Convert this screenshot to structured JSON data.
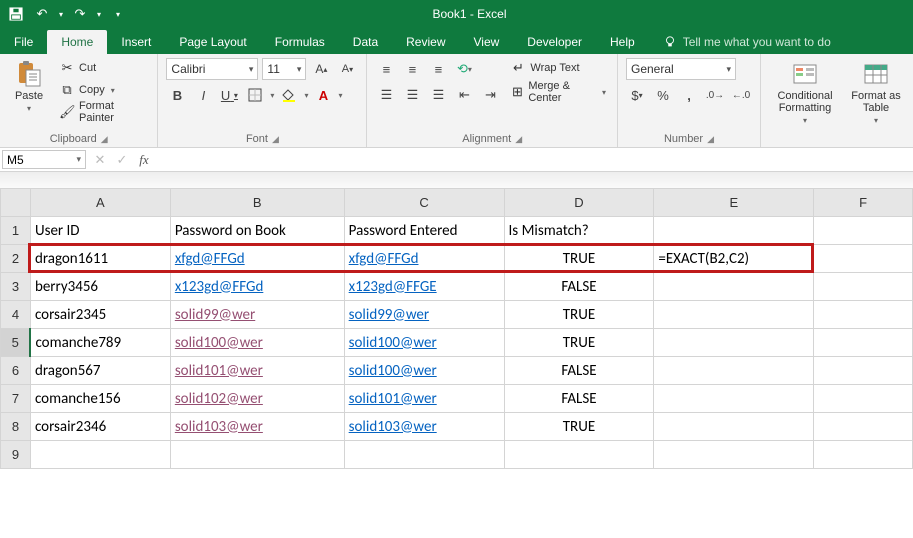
{
  "title": "Book1 - Excel",
  "qat": {
    "save": "💾",
    "undo": "↶",
    "redo": "↷"
  },
  "tabs": {
    "file": "File",
    "home": "Home",
    "insert": "Insert",
    "page_layout": "Page Layout",
    "formulas": "Formulas",
    "data": "Data",
    "review": "Review",
    "view": "View",
    "developer": "Developer",
    "help": "Help",
    "tellme": "Tell me what you want to do"
  },
  "ribbon": {
    "clipboard": {
      "label": "Clipboard",
      "paste": "Paste",
      "cut": "Cut",
      "copy": "Copy",
      "format_painter": "Format Painter"
    },
    "font": {
      "label": "Font",
      "font_name": "Calibri",
      "font_size": "11",
      "bold": "B",
      "italic": "I",
      "underline": "U"
    },
    "alignment": {
      "label": "Alignment",
      "wrap": "Wrap Text",
      "merge": "Merge & Center"
    },
    "number": {
      "label": "Number",
      "format": "General"
    },
    "styles": {
      "cond": "Conditional Formatting",
      "table": "Format as Table"
    }
  },
  "formula_bar": {
    "name_box": "M5",
    "formula": ""
  },
  "chart_data": {
    "type": "table",
    "columns": [
      "User ID",
      "Password on Book",
      "Password Entered",
      "Is Mismatch?",
      ""
    ],
    "rows": [
      [
        "dragon1611",
        "xfgd@FFGd",
        "xfgd@FFGd",
        "TRUE",
        "=EXACT(B2,C2)"
      ],
      [
        "berry3456",
        "x123gd@FFGd",
        "x123gd@FFGE",
        "FALSE",
        ""
      ],
      [
        "corsair2345",
        "solid99@wer",
        "solid99@wer",
        "TRUE",
        ""
      ],
      [
        "comanche789",
        "solid100@wer",
        "solid100@wer",
        "TRUE",
        ""
      ],
      [
        "dragon567",
        "solid101@wer",
        "solid100@wer",
        "FALSE",
        ""
      ],
      [
        "comanche156",
        "solid102@wer",
        "solid101@wer",
        "FALSE",
        ""
      ],
      [
        "corsair2346",
        "solid103@wer",
        "solid103@wer",
        "TRUE",
        ""
      ]
    ],
    "link_visited_B_from_row_index": 2
  },
  "col_letters": [
    "A",
    "B",
    "C",
    "D",
    "E",
    "F"
  ],
  "row_numbers": [
    "1",
    "2",
    "3",
    "4",
    "5",
    "6",
    "7",
    "8",
    "9"
  ]
}
